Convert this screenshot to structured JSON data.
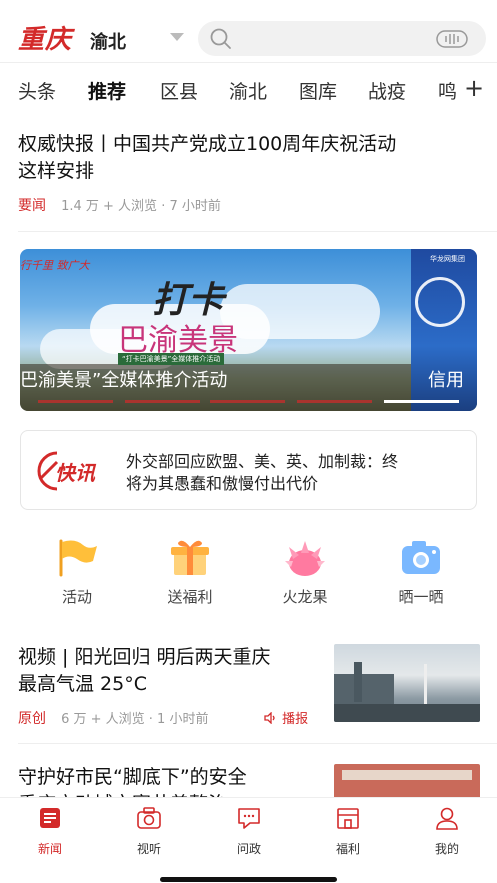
{
  "header": {
    "logo": "重庆",
    "city": "渝北"
  },
  "tabs": [
    "头条",
    "推荐",
    "区县",
    "渝北",
    "图库",
    "战疫",
    "鸣"
  ],
  "tabs_active": 1,
  "news1": {
    "title_line1": "权威快报丨中国共产党成立100周年庆祝活动",
    "title_line2": "这样安排",
    "tag": "要闻",
    "meta": "1.4 万 + 人浏览 · 7 小时前"
  },
  "banner": {
    "logo_text": "行千里 致广大",
    "title": "打卡",
    "subtitle": "巴渝美景",
    "sub_caption": "“打卡巴渝美景”全媒体推介活动",
    "caption": "巴渝美景”全媒体推介活动",
    "next_caption": "信用",
    "next_logo": "华龙网集团"
  },
  "flash": {
    "logo": "快讯",
    "line1": "外交部回应欧盟、美、英、加制裁：终",
    "line2": "将为其愚蠢和傲慢付出代价"
  },
  "quick": [
    {
      "label": "活动",
      "icon": "flag-icon"
    },
    {
      "label": "送福利",
      "icon": "gift-icon"
    },
    {
      "label": "火龙果",
      "icon": "dragonfruit-icon"
    },
    {
      "label": "晒一晒",
      "icon": "camera-icon"
    }
  ],
  "news2": {
    "title_line1": "视频 | 阳光回归 明后两天重庆",
    "title_line2": "最高气温 25°C",
    "tag": "原创",
    "meta": "6 万 + 人浏览 · 1 小时前",
    "broadcast": "播报"
  },
  "news3": {
    "title_line1": "守护好市民“脚底下”的安全",
    "title_line2": "重庆启动城市窨井盖整治"
  },
  "bottom_nav": [
    {
      "label": "新闻",
      "icon": "news-icon"
    },
    {
      "label": "视听",
      "icon": "camera-tab-icon"
    },
    {
      "label": "问政",
      "icon": "chat-icon"
    },
    {
      "label": "福利",
      "icon": "store-icon"
    },
    {
      "label": "我的",
      "icon": "user-icon"
    }
  ],
  "colors": {
    "brand": "#d32a2a"
  }
}
